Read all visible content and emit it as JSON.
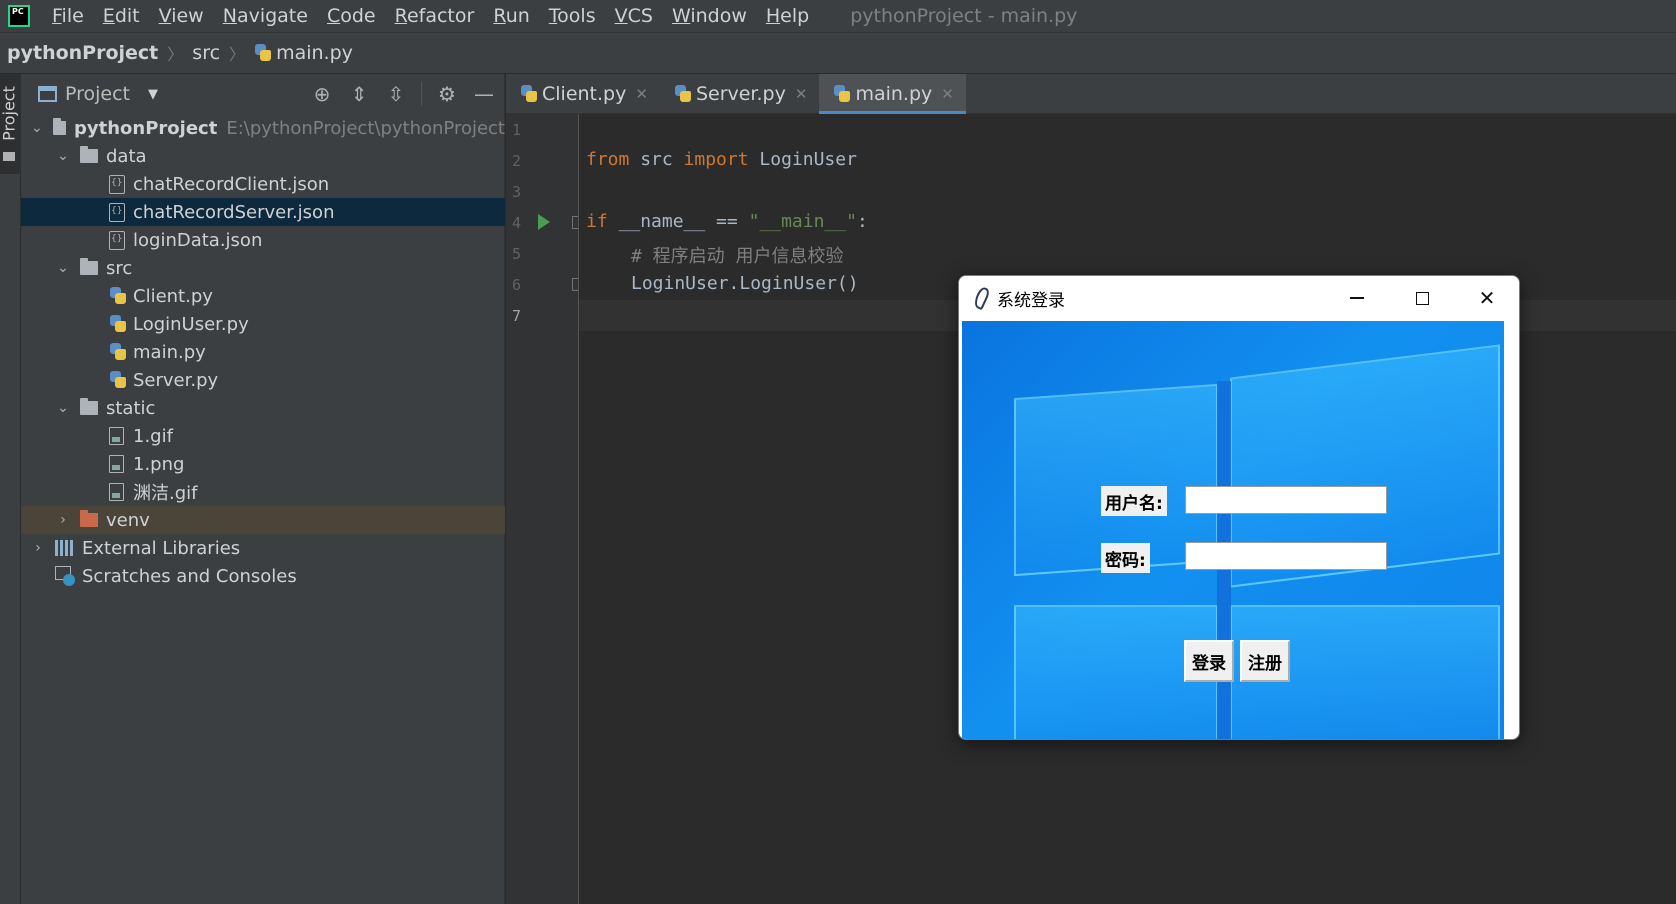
{
  "menubar": {
    "items": [
      "File",
      "Edit",
      "View",
      "Navigate",
      "Code",
      "Refactor",
      "Run",
      "Tools",
      "VCS",
      "Window",
      "Help"
    ],
    "window_title": "pythonProject - main.py"
  },
  "breadcrumb": {
    "project": "pythonProject",
    "folder": "src",
    "file": "main.py"
  },
  "tool_stripe": {
    "project_label": "Project"
  },
  "project_panel": {
    "title": "Project",
    "root": {
      "name": "pythonProject",
      "path": "E:\\pythonProject\\pythonProject"
    },
    "data_folder": "data",
    "data_files": [
      "chatRecordClient.json",
      "chatRecordServer.json",
      "loginData.json"
    ],
    "src_folder": "src",
    "src_files": [
      "Client.py",
      "LoginUser.py",
      "main.py",
      "Server.py"
    ],
    "static_folder": "static",
    "static_files": [
      "1.gif",
      "1.png",
      "渊洁.gif"
    ],
    "venv_folder": "venv",
    "external_libraries": "External Libraries",
    "scratches": "Scratches and Consoles"
  },
  "editor": {
    "tabs": [
      {
        "label": "Client.py",
        "active": false
      },
      {
        "label": "Server.py",
        "active": false
      },
      {
        "label": "main.py",
        "active": true
      }
    ],
    "line_numbers": [
      "1",
      "2",
      "3",
      "4",
      "5",
      "6",
      "7"
    ],
    "code": {
      "l2_from": "from",
      "l2_mod": " src ",
      "l2_import": "import",
      "l2_name": " LoginUser",
      "l4_if": "if",
      "l4_mid": " __name__ == ",
      "l4_str": "\"__main__\"",
      "l4_colon": ":",
      "l5_comment": "# 程序启动 用户信息校验",
      "l6_call": "LoginUser.LoginUser()"
    }
  },
  "login_window": {
    "title": "系统登录",
    "username_label": "用户名:",
    "password_label": "密码:",
    "username_value": "",
    "password_value": "",
    "login_button": "登录",
    "register_button": "注册"
  },
  "colors": {
    "accent": "#4a88c7",
    "keyword": "#cc7832",
    "string": "#6a8759",
    "run_green": "#499c54",
    "selection": "#0d293e"
  }
}
